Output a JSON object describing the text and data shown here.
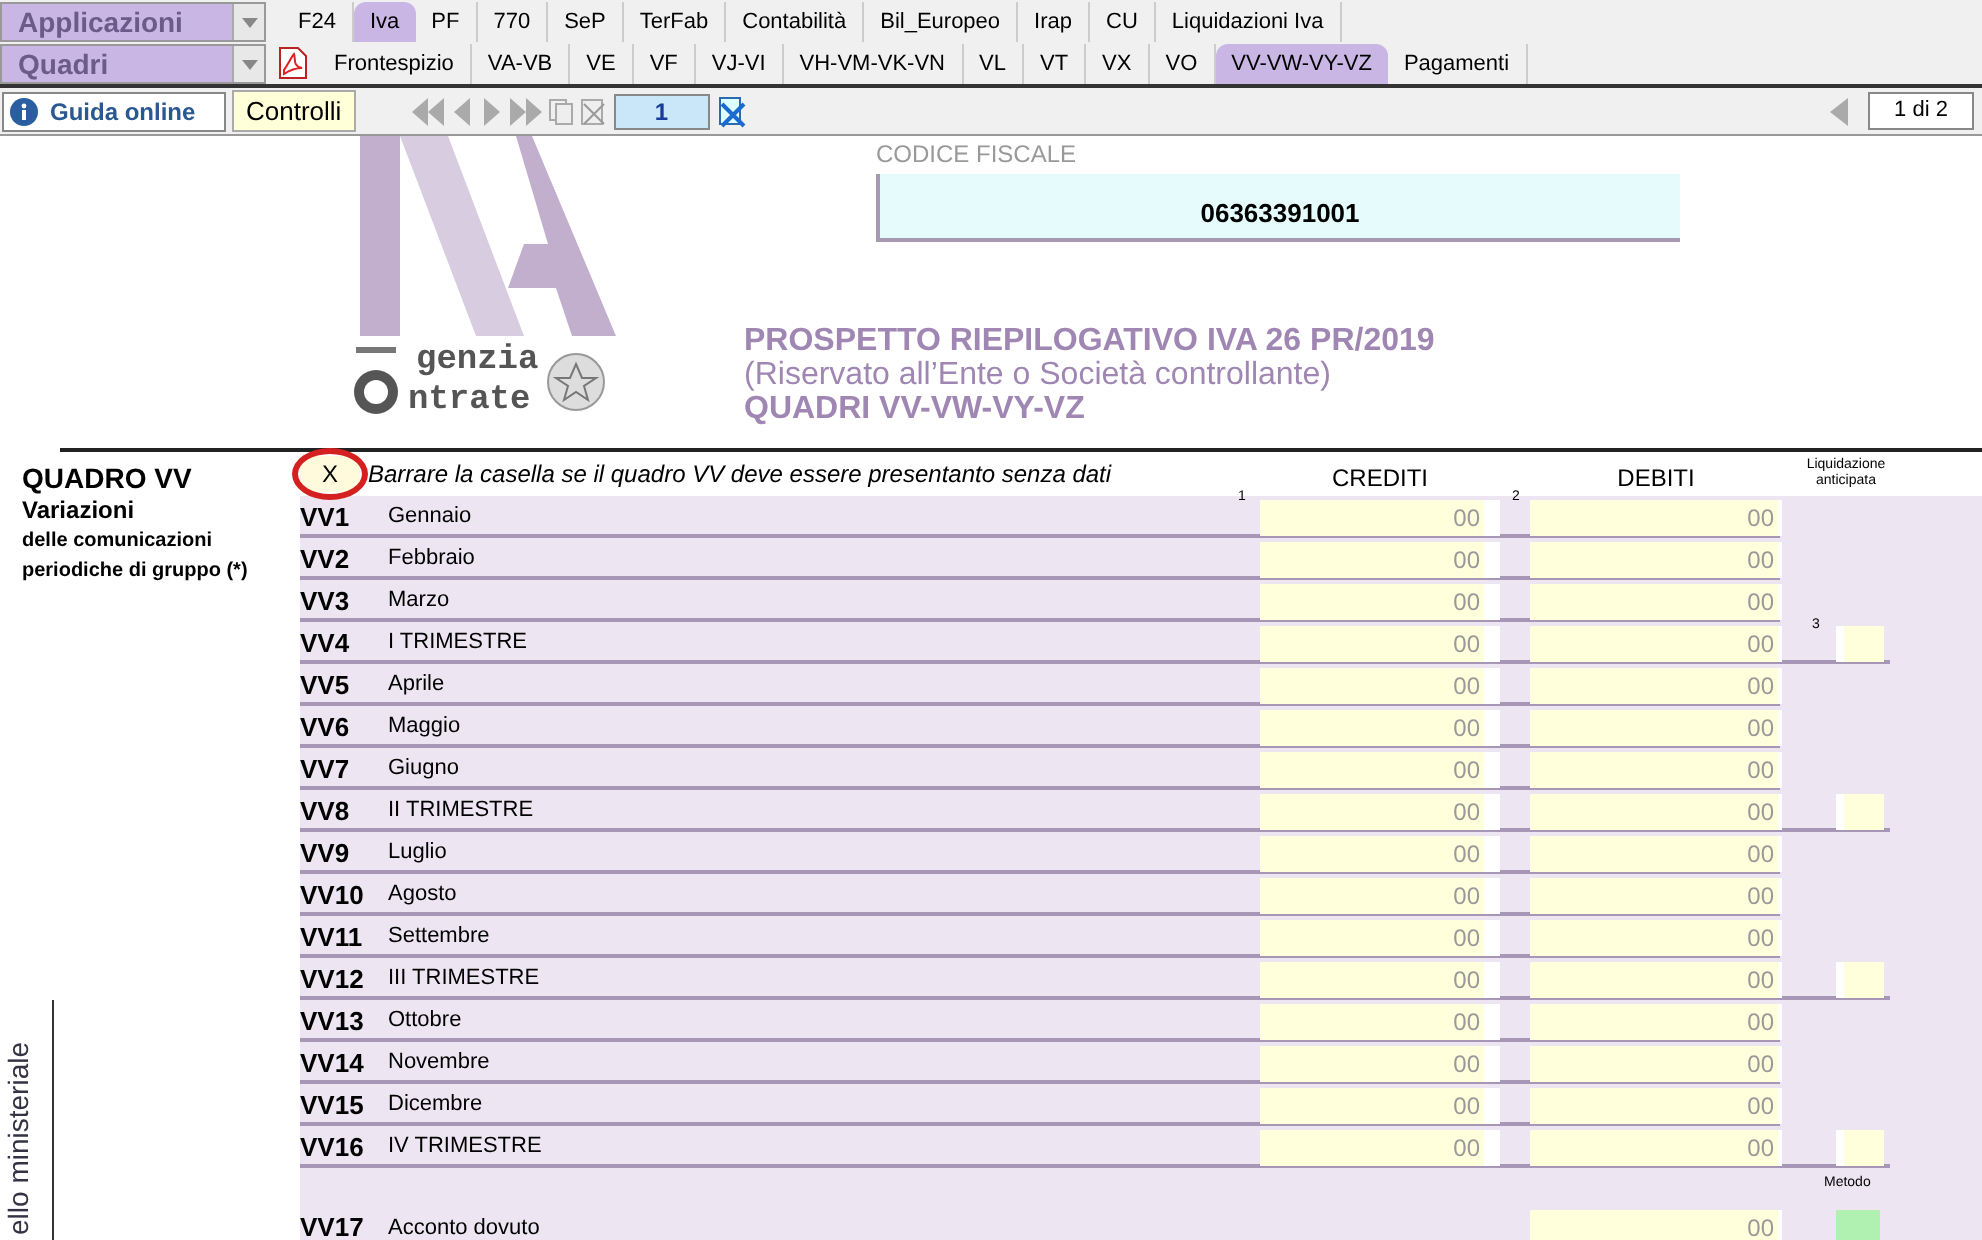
{
  "toolbar_rows": [
    {
      "dropdown": "Applicazioni",
      "tabs": [
        {
          "label": "F24",
          "selected": false
        },
        {
          "label": "Iva",
          "selected": true
        },
        {
          "label": "PF",
          "selected": false
        },
        {
          "label": "770",
          "selected": false
        },
        {
          "label": "SeP",
          "selected": false
        },
        {
          "label": "TerFab",
          "selected": false
        },
        {
          "label": "Contabilità",
          "selected": false
        },
        {
          "label": "Bil_Europeo",
          "selected": false
        },
        {
          "label": "Irap",
          "selected": false
        },
        {
          "label": "CU",
          "selected": false
        },
        {
          "label": "Liquidazioni Iva",
          "selected": false
        }
      ]
    },
    {
      "dropdown": "Quadri",
      "tabs": [
        {
          "label": "Frontespizio",
          "selected": false
        },
        {
          "label": "VA-VB",
          "selected": false
        },
        {
          "label": "VE",
          "selected": false
        },
        {
          "label": "VF",
          "selected": false
        },
        {
          "label": "VJ-VI",
          "selected": false
        },
        {
          "label": "VH-VM-VK-VN",
          "selected": false
        },
        {
          "label": "VL",
          "selected": false
        },
        {
          "label": "VT",
          "selected": false
        },
        {
          "label": "VX",
          "selected": false
        },
        {
          "label": "VO",
          "selected": false
        },
        {
          "label": "VV-VW-VY-VZ",
          "selected": true
        },
        {
          "label": "Pagamenti",
          "selected": false
        }
      ]
    }
  ],
  "actions": {
    "help_button": "Guida online",
    "check_button": "Controlli",
    "page_number": "1",
    "page_counter": "1 di 2"
  },
  "form": {
    "side_caption": "ello ministeriale",
    "codice_fiscale_label": "CODICE FISCALE",
    "codice_fiscale": "06363391001",
    "logo_text": [
      "genzia",
      "ntrate"
    ],
    "title_lines": [
      "PROSPETTO RIEPILOGATIVO IVA 26 PR/2019",
      "(Riservato all’Ente o Società controllante)",
      "QUADRI VV-VW-VY-VZ"
    ],
    "section": {
      "title": "QUADRO VV",
      "subtitle_lines": [
        "Variazioni",
        "delle comunicazioni",
        "periodiche di gruppo (*)"
      ],
      "empty_checkbox": {
        "value": "X",
        "highlighted": true
      },
      "empty_checkbox_note": "Barrare la casella se il quadro VV deve essere presentanto senza dati",
      "columns": [
        {
          "title": "CREDITI",
          "number": "1"
        },
        {
          "title": "DEBITI",
          "number": "2"
        },
        {
          "title": "Liquidazione anticipata",
          "number": "3"
        }
      ],
      "rows": [
        {
          "kind": "month",
          "code": "VV1",
          "label": "Gennaio",
          "crediti": "00",
          "debiti": "00"
        },
        {
          "kind": "month",
          "code": "VV2",
          "label": "Febbraio",
          "crediti": "00",
          "debiti": "00"
        },
        {
          "kind": "month",
          "code": "VV3",
          "label": "Marzo",
          "crediti": "00",
          "debiti": "00"
        },
        {
          "kind": "quarter",
          "code": "VV4",
          "label": "I TRIMESTRE",
          "crediti": "00",
          "debiti": "00"
        },
        {
          "kind": "month",
          "code": "VV5",
          "label": "Aprile",
          "crediti": "00",
          "debiti": "00"
        },
        {
          "kind": "month",
          "code": "VV6",
          "label": "Maggio",
          "crediti": "00",
          "debiti": "00"
        },
        {
          "kind": "month",
          "code": "VV7",
          "label": "Giugno",
          "crediti": "00",
          "debiti": "00"
        },
        {
          "kind": "quarter",
          "code": "VV8",
          "label": "II TRIMESTRE",
          "crediti": "00",
          "debiti": "00"
        },
        {
          "kind": "month",
          "code": "VV9",
          "label": "Luglio",
          "crediti": "00",
          "debiti": "00"
        },
        {
          "kind": "month",
          "code": "VV10",
          "label": "Agosto",
          "crediti": "00",
          "debiti": "00"
        },
        {
          "kind": "month",
          "code": "VV11",
          "label": "Settembre",
          "crediti": "00",
          "debiti": "00"
        },
        {
          "kind": "quarter",
          "code": "VV12",
          "label": "III TRIMESTRE",
          "crediti": "00",
          "debiti": "00"
        },
        {
          "kind": "month",
          "code": "VV13",
          "label": "Ottobre",
          "crediti": "00",
          "debiti": "00"
        },
        {
          "kind": "month",
          "code": "VV14",
          "label": "Novembre",
          "crediti": "00",
          "debiti": "00"
        },
        {
          "kind": "month",
          "code": "VV15",
          "label": "Dicembre",
          "crediti": "00",
          "debiti": "00"
        },
        {
          "kind": "quarter",
          "code": "VV16",
          "label": "IV TRIMESTRE",
          "crediti": "00",
          "debiti": "00"
        },
        {
          "kind": "acconto",
          "code": "VV17",
          "label": "Acconto dovuto",
          "debiti": "00",
          "method_label": "Metodo"
        }
      ]
    }
  }
}
